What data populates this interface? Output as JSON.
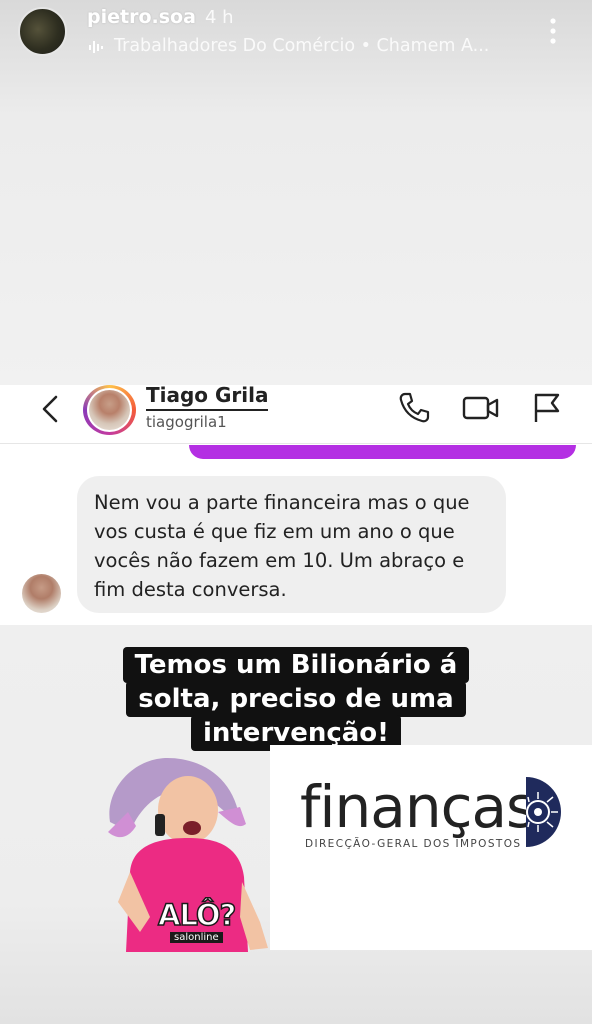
{
  "story": {
    "username": "pietro.soa",
    "time": "4 h",
    "music": "Trabalhadores Do Comércio • Chamem A...",
    "icons": [
      "music-icon",
      "more-icon"
    ]
  },
  "dm": {
    "name": "Tiago Grila",
    "handle": "tiagogrila1",
    "message": "Nem vou a parte financeira mas o que vos custa é que fiz em um ano o que vocês não fazem em 10. Um abraço e fim desta conversa.",
    "icons": [
      "back-icon",
      "phone-icon",
      "video-icon",
      "flag-icon"
    ],
    "accent_color": "#b42fe3"
  },
  "caption": {
    "lines": [
      "Temos um Bilionário á",
      "solta, preciso de uma",
      "intervenção!"
    ]
  },
  "financas": {
    "word": "finanças",
    "subtitle": "DIRECÇÃO-GERAL DOS IMPOSTOS",
    "brand_color": "#1f2a5c"
  },
  "sticker": {
    "text": "ALÔ?",
    "brand": "salonline"
  }
}
